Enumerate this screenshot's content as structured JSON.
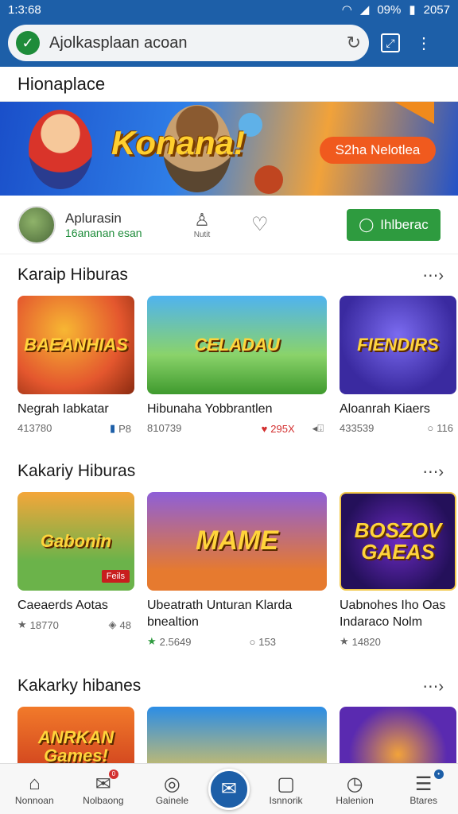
{
  "status": {
    "time": "1:3:68",
    "battery": "09%",
    "clock": "2057"
  },
  "urlbar": {
    "url": "Ajolkasplaan acoan"
  },
  "page": {
    "title": "Hionaplace"
  },
  "banner": {
    "title": "Konana!",
    "button": "S2ha Nelotlea"
  },
  "developer": {
    "name": "Aplurasin",
    "sub": "16ananan esan",
    "action_label": "Nutit",
    "follow_label": "Ihlberac"
  },
  "sections": [
    {
      "title": "Karaip Hiburas",
      "cards": [
        {
          "thumb_text": "BAEANHIAS",
          "title": "Negrah Iabkatar",
          "meta_left": "413780",
          "meta_right": "P8"
        },
        {
          "thumb_text": "CELADAU",
          "title": "Hibunaha Yobbrantlen",
          "meta_left": "810739",
          "meta_right": "295X"
        },
        {
          "thumb_text": "FIENDIRS",
          "title": "Aloanrah Kiaers",
          "meta_left": "433539",
          "meta_right": "116"
        }
      ]
    },
    {
      "title": "Kakariy Hiburas",
      "cards": [
        {
          "thumb_text": "Gabonin",
          "badge": "Feils",
          "title": "Caeaerds Aotas",
          "meta_left": "18770",
          "meta_right": "48"
        },
        {
          "thumb_text": "MAME",
          "title": "Ubeatrath Unturan Klarda bnealtion",
          "meta_left": "2.5649",
          "meta_right": "153"
        },
        {
          "thumb_text": "BOSZOV GAEAS",
          "title": "Uabnohes Iho Oas Indaraco Nolm",
          "meta_left": "14820",
          "meta_right": ""
        }
      ]
    },
    {
      "title": "Kakarky hibanes",
      "cards": [
        {
          "thumb_text": "ANRKAN Games!"
        },
        {
          "thumb_text": ""
        },
        {
          "thumb_text": ""
        }
      ]
    }
  ],
  "nav": {
    "items": [
      "Nonnoan",
      "Nolbaong",
      "Gainele",
      "",
      "Isnnorik",
      "Halenion",
      "Btares"
    ]
  }
}
